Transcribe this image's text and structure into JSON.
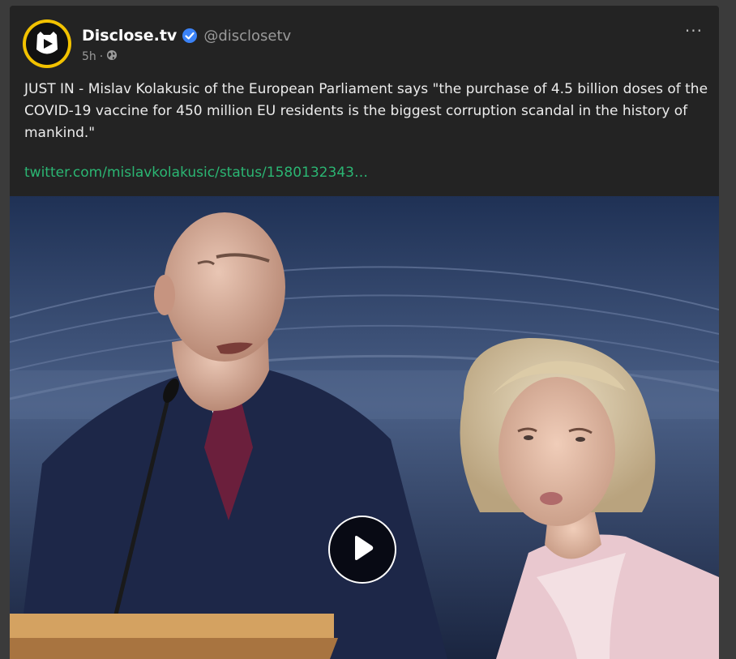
{
  "post": {
    "display_name": "Disclose.tv",
    "handle": "@disclosetv",
    "time_ago": "5h",
    "separator": "·",
    "text": "JUST IN - Mislav Kolakusic of the European Parliament says \"the purchase of 4.5 billion doses of the COVID-19 vaccine for 450 million EU residents is the biggest corruption scandal in the history of mankind.\"",
    "link": "twitter.com/mislavkolakusic/status/1580132343…",
    "more_label": "···"
  },
  "icons": {
    "avatar": "disclose-tv-logo",
    "verified": "verified-badge-icon",
    "visibility": "globe-icon",
    "more": "more-options-icon",
    "play": "play-icon"
  },
  "colors": {
    "card_bg": "#232323",
    "page_bg": "#3b3b3b",
    "link": "#2bb673",
    "verified": "#3b82f6",
    "avatar_ring": "#f2c200"
  }
}
